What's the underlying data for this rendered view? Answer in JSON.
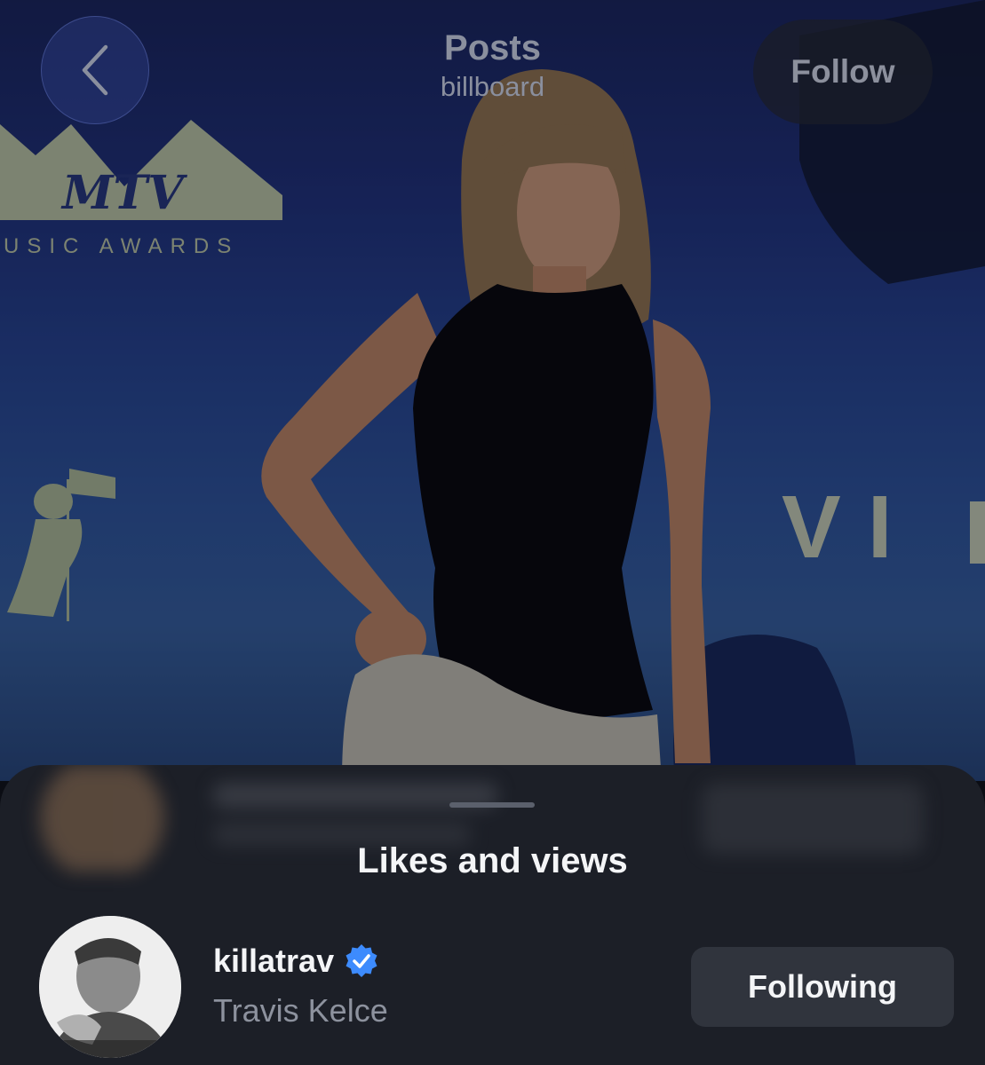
{
  "header": {
    "title": "Posts",
    "subtitle": "billboard",
    "follow_label": "Follow",
    "back_icon": "chevron-left-icon"
  },
  "photo": {
    "backdrop_text": "USIC AWARDS",
    "backdrop_logo": "MTV",
    "backdrop_word": "VI"
  },
  "sheet": {
    "title": "Likes and views",
    "users": [
      {
        "username": "killatrav",
        "verified": true,
        "full_name": "Travis Kelce",
        "button_label": "Following"
      }
    ]
  },
  "colors": {
    "sheet_bg": "#1c1f27",
    "button_bg": "#30343d",
    "verified_blue": "#3d8bfd",
    "muted_text": "#8d929e"
  }
}
